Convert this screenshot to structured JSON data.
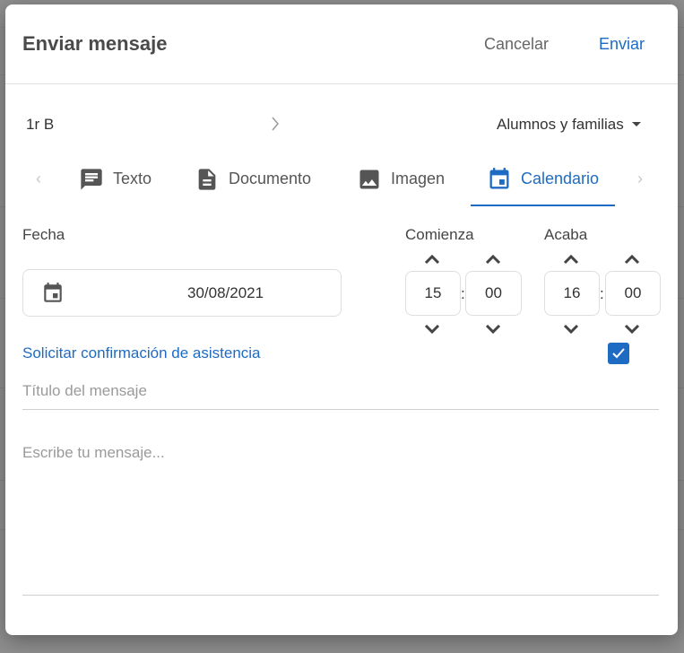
{
  "dialog": {
    "title": "Enviar mensaje",
    "cancel_label": "Cancelar",
    "send_label": "Enviar"
  },
  "recipient": {
    "group": "1r B",
    "audience": "Alumnos y familias"
  },
  "tabs": [
    {
      "label": "Texto",
      "icon": "message-icon"
    },
    {
      "label": "Documento",
      "icon": "document-icon"
    },
    {
      "label": "Imagen",
      "icon": "image-icon"
    },
    {
      "label": "Calendario",
      "icon": "calendar-icon",
      "active": true
    }
  ],
  "event": {
    "date_label": "Fecha",
    "date_value": "30/08/2021",
    "start_label": "Comienza",
    "start_hour": "15",
    "start_minute": "00",
    "end_label": "Acaba",
    "end_hour": "16",
    "end_minute": "00",
    "separator": ":",
    "confirm_label": "Solicitar confirmación de asistencia",
    "confirm_checked": true
  },
  "message": {
    "title_placeholder": "Título del mensaje",
    "body_placeholder": "Escribe tu mensaje..."
  },
  "colors": {
    "accent": "#1e6bc4",
    "text": "#333333",
    "muted": "#9a9a9a"
  }
}
